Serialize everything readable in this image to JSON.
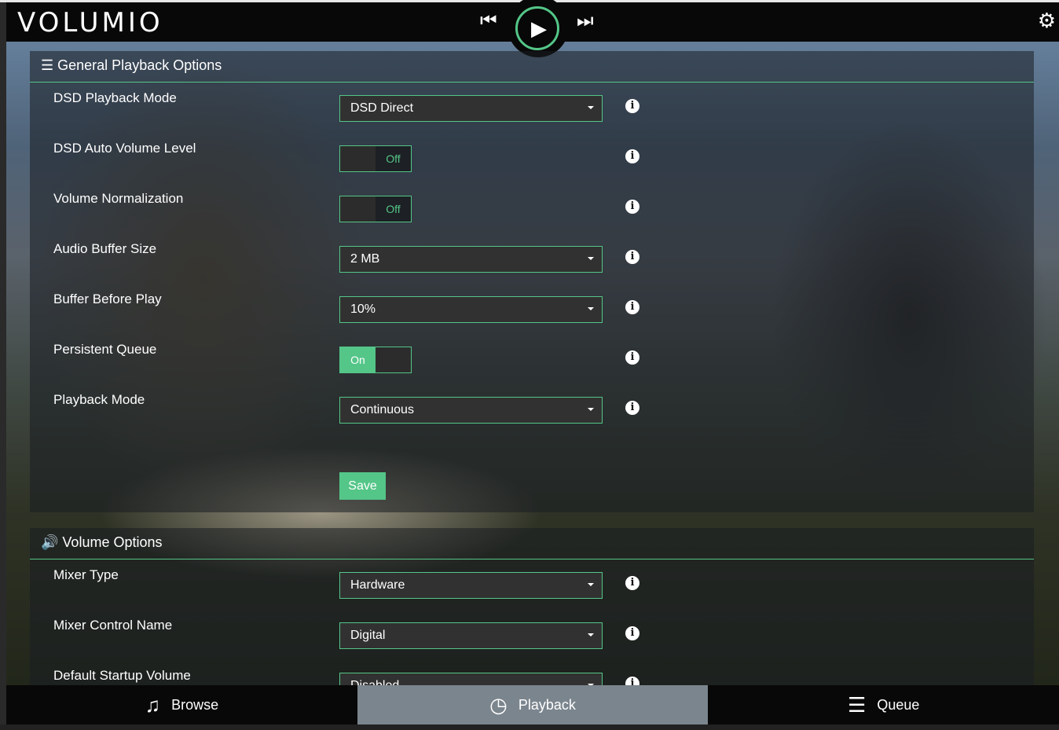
{
  "app": {
    "logo": "VOLUMIO",
    "accent": "#54c688"
  },
  "player": {
    "prev_icon": "skip-previous-icon",
    "play_icon": "play-icon",
    "next_icon": "skip-next-icon",
    "settings_icon": "gear-icon"
  },
  "general": {
    "title": "General Playback Options",
    "icon": "sliders-icon",
    "save_label": "Save",
    "rows": [
      {
        "label": "DSD Playback Mode",
        "type": "select",
        "value": "DSD Direct"
      },
      {
        "label": "DSD Auto Volume Level",
        "type": "toggle",
        "value": "Off"
      },
      {
        "label": "Volume Normalization",
        "type": "toggle",
        "value": "Off"
      },
      {
        "label": "Audio Buffer Size",
        "type": "select",
        "value": "2 MB"
      },
      {
        "label": "Buffer Before Play",
        "type": "select",
        "value": "10%"
      },
      {
        "label": "Persistent Queue",
        "type": "toggle",
        "value": "On"
      },
      {
        "label": "Playback Mode",
        "type": "select",
        "value": "Continuous"
      }
    ]
  },
  "volume": {
    "title": "Volume Options",
    "icon": "volume-icon",
    "rows": [
      {
        "label": "Mixer Type",
        "type": "select",
        "value": "Hardware"
      },
      {
        "label": "Mixer Control Name",
        "type": "select",
        "value": "Digital"
      },
      {
        "label": "Default Startup Volume",
        "type": "select",
        "value": "Disabled"
      }
    ]
  },
  "nav": [
    {
      "label": "Browse",
      "icon": "music-note-icon"
    },
    {
      "label": "Playback",
      "icon": "clock-icon",
      "active": true
    },
    {
      "label": "Queue",
      "icon": "list-icon"
    }
  ]
}
